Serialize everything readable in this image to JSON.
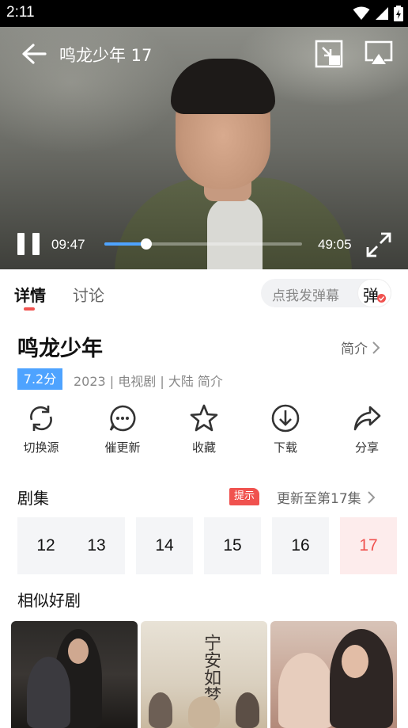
{
  "status_bar": {
    "time": "2:11",
    "icons": [
      "wifi-icon",
      "signal-icon",
      "battery-icon"
    ]
  },
  "player": {
    "title": "鸣龙少年 17",
    "current_time": "09:47",
    "total_time": "49:05",
    "progress": 0.21,
    "accent": "#4ea3ff"
  },
  "tabs": [
    {
      "label": "详情",
      "active": true
    },
    {
      "label": "讨论",
      "active": false
    }
  ],
  "danmaku": {
    "placeholder": "点我发弹幕",
    "button_label": "弹"
  },
  "show": {
    "title": "鸣龙少年",
    "intro_label": "简介",
    "score": "7.2分",
    "meta": "2023 | 电视剧 | 大陆 简介"
  },
  "actions": [
    {
      "label": "切换源",
      "icon": "refresh-icon"
    },
    {
      "label": "催更新",
      "icon": "chat-icon"
    },
    {
      "label": "收藏",
      "icon": "star-icon"
    },
    {
      "label": "下载",
      "icon": "download-icon"
    },
    {
      "label": "分享",
      "icon": "share-icon"
    }
  ],
  "episodes": {
    "heading": "剧集",
    "hint": "提示",
    "update_text": "更新至第17集",
    "items": [
      "12",
      "13",
      "14",
      "15",
      "16",
      "17"
    ],
    "current": "17"
  },
  "similar": {
    "heading": "相似好剧",
    "posters": [
      {
        "title_art": ""
      },
      {
        "title_art": "宁安如梦"
      },
      {
        "title_art": ""
      }
    ]
  },
  "colors": {
    "accent_red": "#f0524f",
    "accent_blue": "#4ea3ff"
  }
}
